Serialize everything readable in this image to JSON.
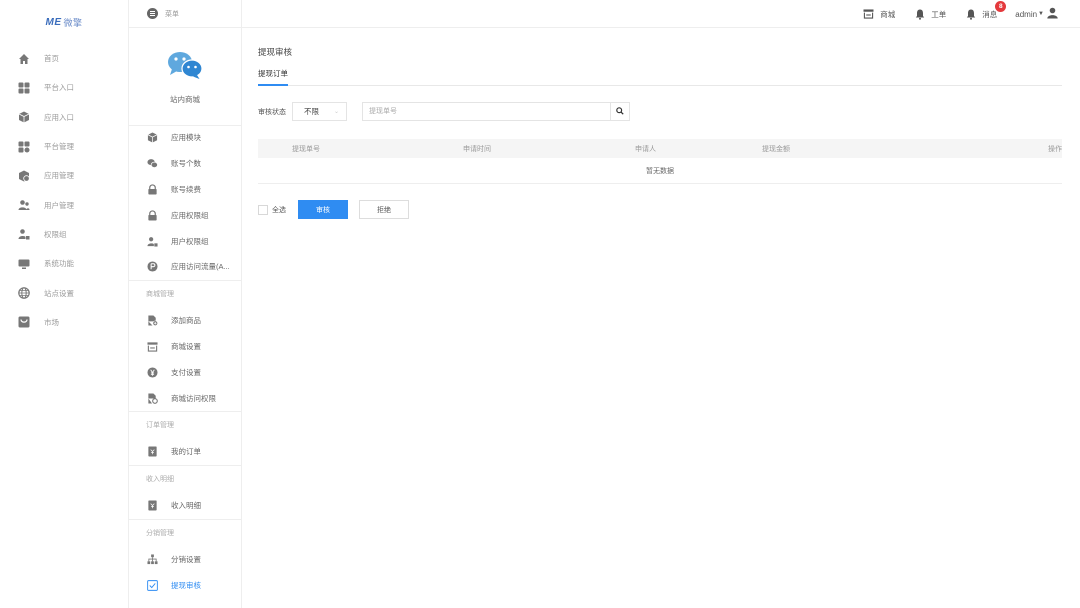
{
  "brand": {
    "logo_me": "ME",
    "logo_cn": "微擎"
  },
  "rail": {
    "items": [
      {
        "label": "首页",
        "icon": "home-icon"
      },
      {
        "label": "平台入口",
        "icon": "grid-icon"
      },
      {
        "label": "应用入口",
        "icon": "cube-icon"
      },
      {
        "label": "平台管理",
        "icon": "grid-icon"
      },
      {
        "label": "应用管理",
        "icon": "settings-icon"
      },
      {
        "label": "用户管理",
        "icon": "users-icon"
      },
      {
        "label": "权限组",
        "icon": "user-lock-icon"
      },
      {
        "label": "系统功能",
        "icon": "monitor-icon"
      },
      {
        "label": "站点设置",
        "icon": "globe-icon"
      },
      {
        "label": "市场",
        "icon": "store-icon"
      }
    ]
  },
  "sidebar": {
    "title": "站内商城",
    "items_a": [
      {
        "label": "应用模块",
        "icon": "cube-icon"
      },
      {
        "label": "账号个数",
        "icon": "wechat-icon"
      },
      {
        "label": "账号续费",
        "icon": "lock-icon"
      },
      {
        "label": "应用权限组",
        "icon": "lock-icon"
      },
      {
        "label": "用户权限组",
        "icon": "user-lock-icon"
      },
      {
        "label": "应用访问流量(A...",
        "icon": "coin-icon"
      }
    ],
    "group_shop": "商城管理",
    "items_shop": [
      {
        "label": "添加商品",
        "icon": "add-file-icon"
      },
      {
        "label": "商城设置",
        "icon": "shop-icon"
      },
      {
        "label": "支付设置",
        "icon": "yen-icon"
      },
      {
        "label": "商城访问权限",
        "icon": "settings-file-icon"
      }
    ],
    "group_order": "订单管理",
    "items_order": [
      {
        "label": "我的订单",
        "icon": "order-icon"
      }
    ],
    "group_income": "收入明细",
    "items_income": [
      {
        "label": "收入明细",
        "icon": "order-icon"
      }
    ],
    "group_dist": "分销管理",
    "items_dist": [
      {
        "label": "分销设置",
        "icon": "sitemap-icon"
      },
      {
        "label": "提现审核",
        "icon": "checkbox-icon"
      }
    ]
  },
  "topbar": {
    "menu_label": "菜单",
    "links": [
      {
        "label": "商城",
        "icon": "shop-icon"
      },
      {
        "label": "工单",
        "icon": "bell-icon"
      },
      {
        "label": "消息",
        "icon": "bell-icon",
        "badge": "8"
      }
    ],
    "user": "admin"
  },
  "main": {
    "page_title": "提现审核",
    "tab_label": "提现订单",
    "filter_label": "审核状态",
    "select_value": "不限",
    "search_placeholder": "提现单号",
    "columns": [
      "提现单号",
      "申请时间",
      "申请人",
      "提现金额",
      "操作"
    ],
    "empty_text": "暂无数据",
    "select_all": "全选",
    "approve_label": "审核",
    "reject_label": "拒绝"
  },
  "colors": {
    "accent": "#2f8cf2",
    "badge": "#e4393c"
  }
}
